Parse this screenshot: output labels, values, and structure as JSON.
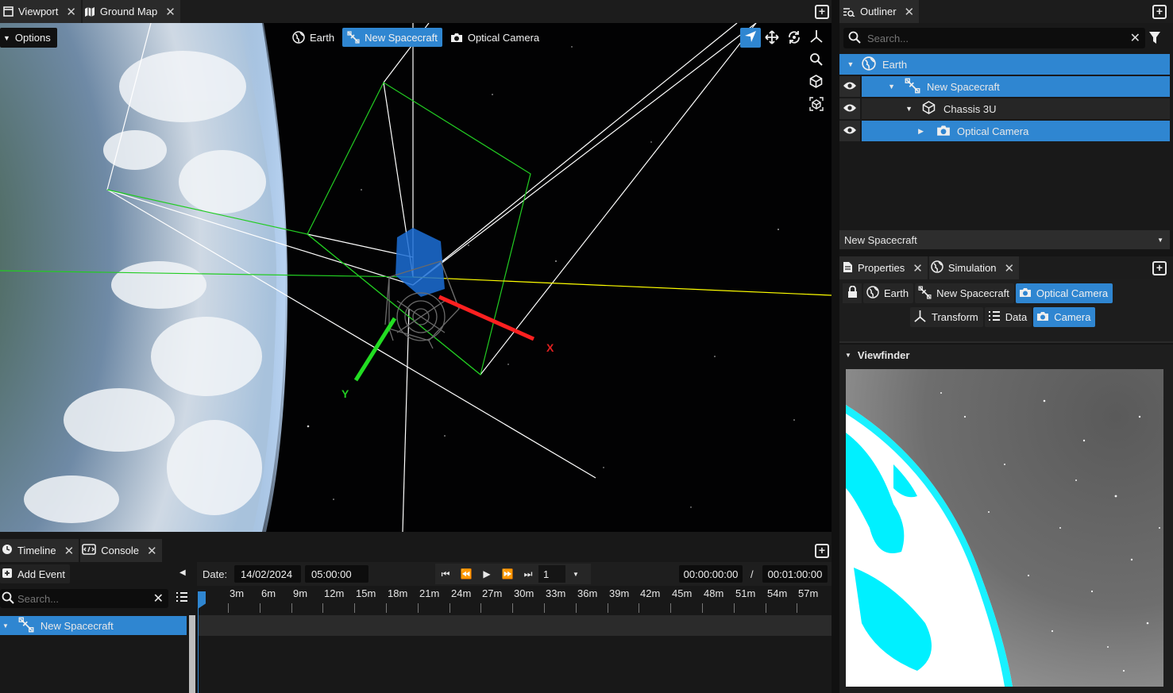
{
  "viewport_tabs": [
    {
      "label": "Viewport",
      "icon": "window-icon"
    },
    {
      "label": "Ground Map",
      "icon": "map-icon"
    }
  ],
  "viewport": {
    "options_label": "Options",
    "crumbs": [
      {
        "label": "Earth",
        "icon": "globe-icon",
        "selected": false
      },
      {
        "label": "New Spacecraft",
        "icon": "satellite-icon",
        "selected": true
      },
      {
        "label": "Optical Camera",
        "icon": "camera-icon",
        "selected": false
      }
    ],
    "axis_x": "X",
    "axis_y": "Y"
  },
  "outliner": {
    "tab_label": "Outliner",
    "search_placeholder": "Search...",
    "tree": [
      {
        "label": "Earth",
        "icon": "globe-icon",
        "selected": true,
        "depth": 0,
        "expanded": true,
        "has_eye": false
      },
      {
        "label": "New Spacecraft",
        "icon": "satellite-icon",
        "selected": true,
        "depth": 1,
        "expanded": true,
        "has_eye": true
      },
      {
        "label": "Chassis 3U",
        "icon": "cube-icon",
        "selected": false,
        "depth": 2,
        "expanded": true,
        "has_eye": true
      },
      {
        "label": "Optical Camera",
        "icon": "camera-icon",
        "selected": true,
        "depth": 3,
        "expanded": false,
        "has_eye": true
      }
    ],
    "selector_value": "New Spacecraft"
  },
  "properties": {
    "tabs": [
      {
        "label": "Properties",
        "icon": "document-icon"
      },
      {
        "label": "Simulation",
        "icon": "globe-icon"
      }
    ],
    "path": [
      {
        "label": "Earth",
        "icon": "globe-icon",
        "selected": false
      },
      {
        "label": "New Spacecraft",
        "icon": "satellite-icon",
        "selected": false
      },
      {
        "label": "Optical Camera",
        "icon": "camera-icon",
        "selected": true
      }
    ],
    "component_tabs": [
      {
        "label": "Transform",
        "icon": "axes-icon",
        "selected": false
      },
      {
        "label": "Data",
        "icon": "list-icon",
        "selected": false
      },
      {
        "label": "Camera",
        "icon": "camera-icon",
        "selected": true
      }
    ],
    "viewfinder_label": "Viewfinder"
  },
  "timeline": {
    "tabs": [
      {
        "label": "Timeline",
        "icon": "clock-icon"
      },
      {
        "label": "Console",
        "icon": "console-icon"
      }
    ],
    "add_event_label": "Add Event",
    "search_placeholder": "Search...",
    "date_label": "Date:",
    "date_value": "14/02/2024",
    "time_value": "05:00:00",
    "speed_value": "1",
    "current_time": "00:00:00:00",
    "separator": "/",
    "end_time": "00:01:00:00",
    "ticks": [
      "3m",
      "6m",
      "9m",
      "12m",
      "15m",
      "18m",
      "21m",
      "24m",
      "27m",
      "30m",
      "33m",
      "36m",
      "39m",
      "42m",
      "45m",
      "48m",
      "51m",
      "54m",
      "57m"
    ],
    "tracks": [
      {
        "label": "New Spacecraft",
        "icon": "satellite-icon"
      }
    ]
  },
  "colors": {
    "accent": "#2f86d1",
    "axis_x": "#ff2020",
    "axis_y": "#22dd22",
    "frustum": "#22cc22",
    "viewfinder_earth": "#00f0ff"
  }
}
